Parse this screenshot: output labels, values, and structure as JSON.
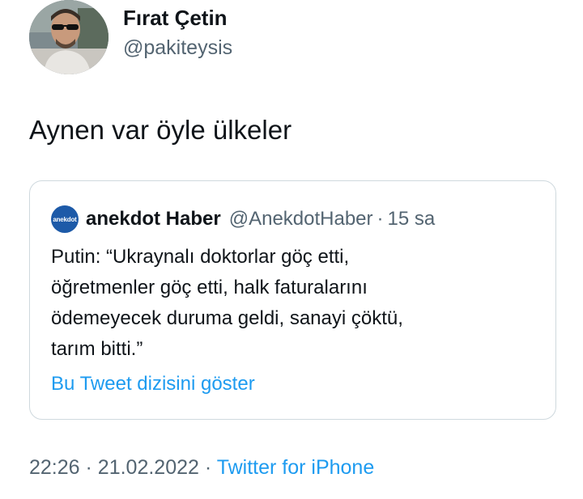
{
  "author": {
    "display_name": "Fırat Çetin",
    "handle": "@pakiteysis"
  },
  "tweet": {
    "text": "Aynen var öyle ülkeler"
  },
  "quoted_tweet": {
    "avatar_text": "anekdot",
    "display_name": "anekdot Haber",
    "handle": "@AnekdotHaber",
    "separator": "·",
    "time": "15 sa",
    "text_lines": [
      "Putin: “Ukraynalı doktorlar göç etti,",
      "öğretmenler göç etti, halk faturalarını",
      "ödemeyecek duruma geldi, sanayi çöktü,",
      "tarım bitti.”"
    ],
    "show_thread_label": "Bu Tweet dizisini göster"
  },
  "meta": {
    "time": "22:26",
    "separator1": "·",
    "date": "21.02.2022",
    "separator2": "·",
    "source": "Twitter for iPhone"
  },
  "colors": {
    "link": "#1d9bf0",
    "secondary_text": "#536471",
    "primary_text": "#0f1419",
    "border": "#cfd9de",
    "quote_avatar_bg": "#1d5aa8"
  }
}
